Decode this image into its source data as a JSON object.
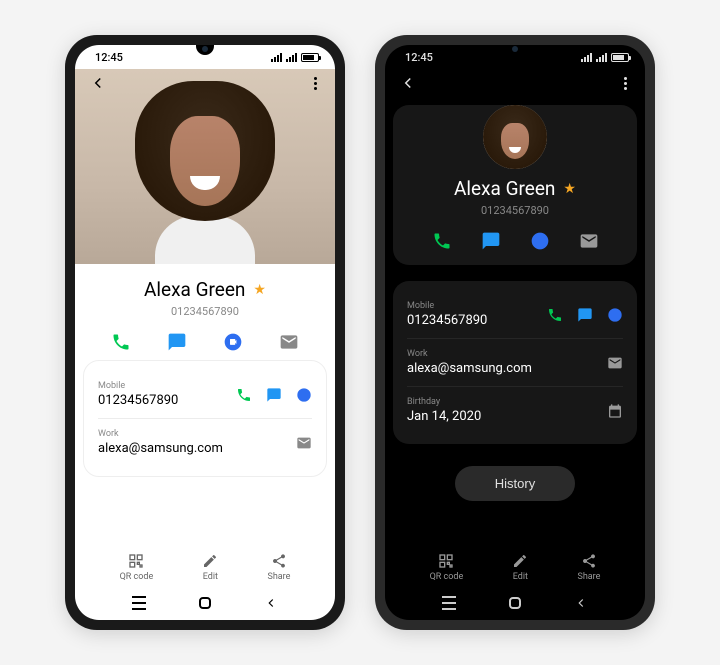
{
  "status": {
    "time": "12:45"
  },
  "contact": {
    "name": "Alexa Green",
    "phone": "01234567890",
    "favorite": "★"
  },
  "details": {
    "mobile_label": "Mobile",
    "mobile_value": "01234567890",
    "work_label": "Work",
    "work_value": "alexa@samsung.com",
    "birthday_label": "Birthday",
    "birthday_value": "Jan 14, 2020"
  },
  "buttons": {
    "history": "History"
  },
  "bottom": {
    "qr": "QR code",
    "edit": "Edit",
    "share": "Share"
  }
}
